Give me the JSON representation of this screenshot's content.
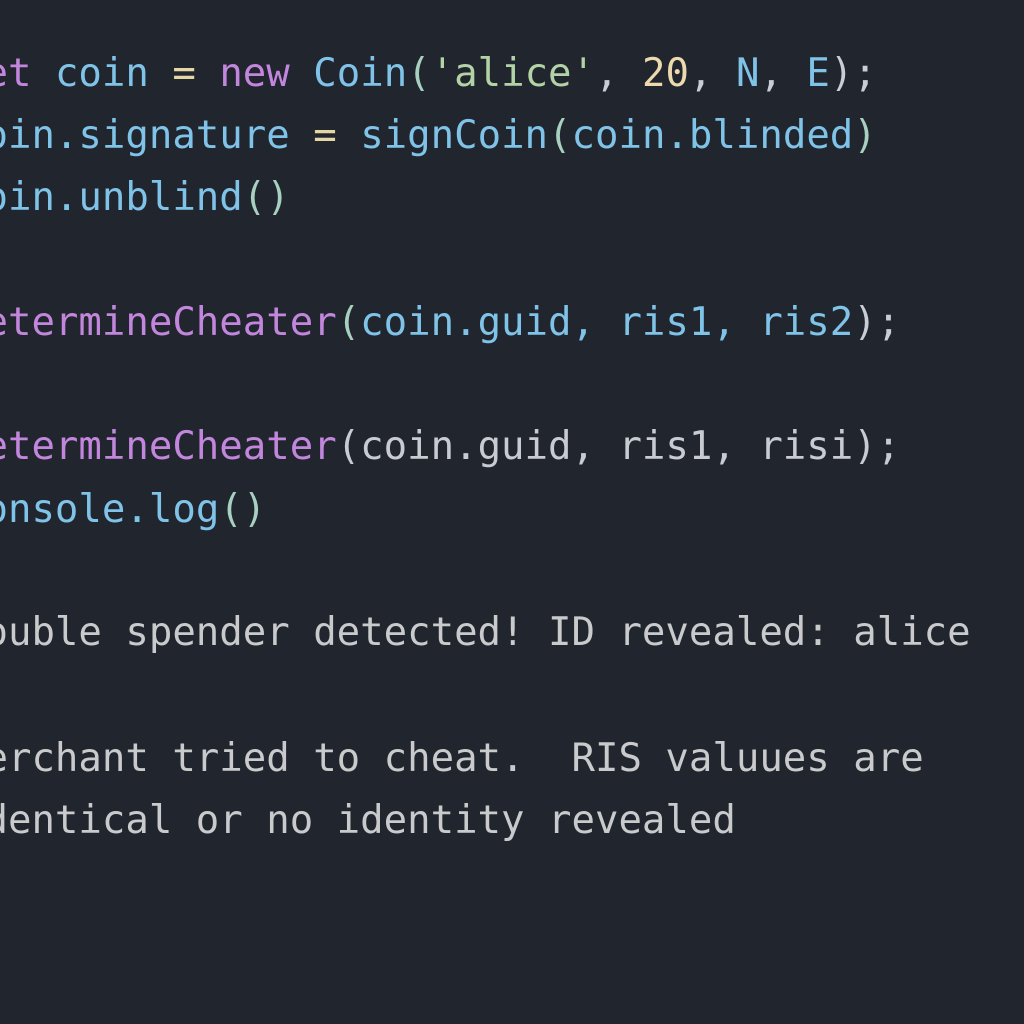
{
  "colors": {
    "background": "#21252e",
    "keyword": "#c286dc",
    "identifier": "#80c3e8",
    "string": "#b3d3a7",
    "number": "#ecd9ad",
    "output_text": "#c9cacc"
  },
  "code": {
    "line1": {
      "kw": "let",
      "t1": " ",
      "var": "coin",
      "t2": " ",
      "op": "=",
      "t3": " ",
      "new": "new",
      "t4": " ",
      "cls": "Coin",
      "p1": "(",
      "str": "'alice'",
      "c1": ", ",
      "num": "20",
      "c2": ", ",
      "n": "N",
      "c3": ", ",
      "e": "E",
      "p2": ");"
    },
    "line2": {
      "obj": "coin",
      "dot": ".",
      "prop": "signature",
      "t1": " ",
      "op": "=",
      "t2": " ",
      "fn": "signCoin",
      "p1": "(",
      "arg": "coin.blinded",
      "p2": ")"
    },
    "line3": {
      "obj": "coin",
      "dot": ".",
      "fn": "unblind",
      "p": "()"
    },
    "line4": {
      "fn": "determineCheater",
      "p1": "(",
      "args": "coin.guid, ris1, ris2",
      "p2": ");"
    },
    "line5": {
      "fn": "determineCheater",
      "rest": "(coin.guid, ris1, risi);"
    },
    "line6": {
      "obj": "console",
      "dot": ".",
      "fn": "log",
      "p": "()"
    }
  },
  "output": {
    "line1": "double spender detected! ID revealed: alice",
    "line2": "merchant tried to cheat.  RIS valuues are",
    "line3": "identical or no identity revealed"
  }
}
